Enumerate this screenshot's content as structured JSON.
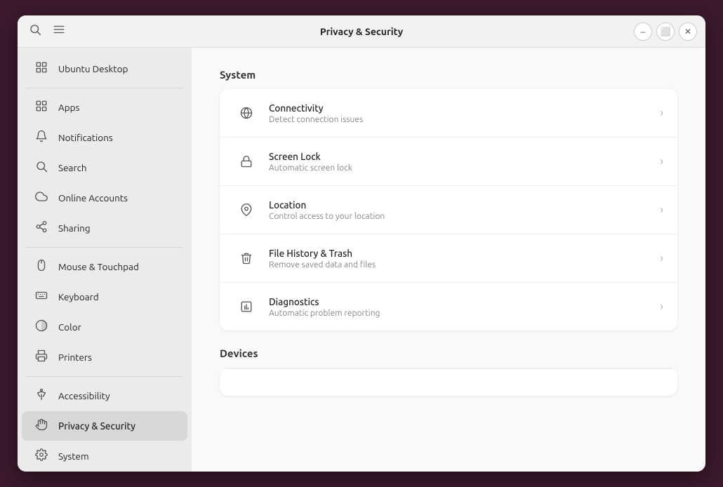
{
  "window": {
    "title": "Privacy & Security",
    "controls": {
      "minimize": "–",
      "maximize": "⬜",
      "close": "✕"
    }
  },
  "sidebar": {
    "items": [
      {
        "id": "ubuntu-desktop",
        "label": "Ubuntu Desktop",
        "icon": "grid"
      },
      {
        "id": "apps",
        "label": "Apps",
        "icon": "grid"
      },
      {
        "id": "notifications",
        "label": "Notifications",
        "icon": "bell"
      },
      {
        "id": "search",
        "label": "Search",
        "icon": "search"
      },
      {
        "id": "online-accounts",
        "label": "Online Accounts",
        "icon": "cloud"
      },
      {
        "id": "sharing",
        "label": "Sharing",
        "icon": "share"
      },
      {
        "id": "mouse-touchpad",
        "label": "Mouse & Touchpad",
        "icon": "mouse"
      },
      {
        "id": "keyboard",
        "label": "Keyboard",
        "icon": "keyboard"
      },
      {
        "id": "color",
        "label": "Color",
        "icon": "color"
      },
      {
        "id": "printers",
        "label": "Printers",
        "icon": "printer"
      },
      {
        "id": "accessibility",
        "label": "Accessibility",
        "icon": "accessibility"
      },
      {
        "id": "privacy-security",
        "label": "Privacy & Security",
        "icon": "hand",
        "active": true
      },
      {
        "id": "system",
        "label": "System",
        "icon": "gear"
      }
    ]
  },
  "main": {
    "sections": [
      {
        "id": "system",
        "title": "System",
        "items": [
          {
            "id": "connectivity",
            "title": "Connectivity",
            "subtitle": "Detect connection issues",
            "icon": "globe"
          },
          {
            "id": "screen-lock",
            "title": "Screen Lock",
            "subtitle": "Automatic screen lock",
            "icon": "lock"
          },
          {
            "id": "location",
            "title": "Location",
            "subtitle": "Control access to your location",
            "icon": "pin"
          },
          {
            "id": "file-history-trash",
            "title": "File History & Trash",
            "subtitle": "Remove saved data and files",
            "icon": "trash"
          },
          {
            "id": "diagnostics",
            "title": "Diagnostics",
            "subtitle": "Automatic problem reporting",
            "icon": "chart"
          }
        ]
      },
      {
        "id": "devices",
        "title": "Devices",
        "items": []
      }
    ]
  }
}
